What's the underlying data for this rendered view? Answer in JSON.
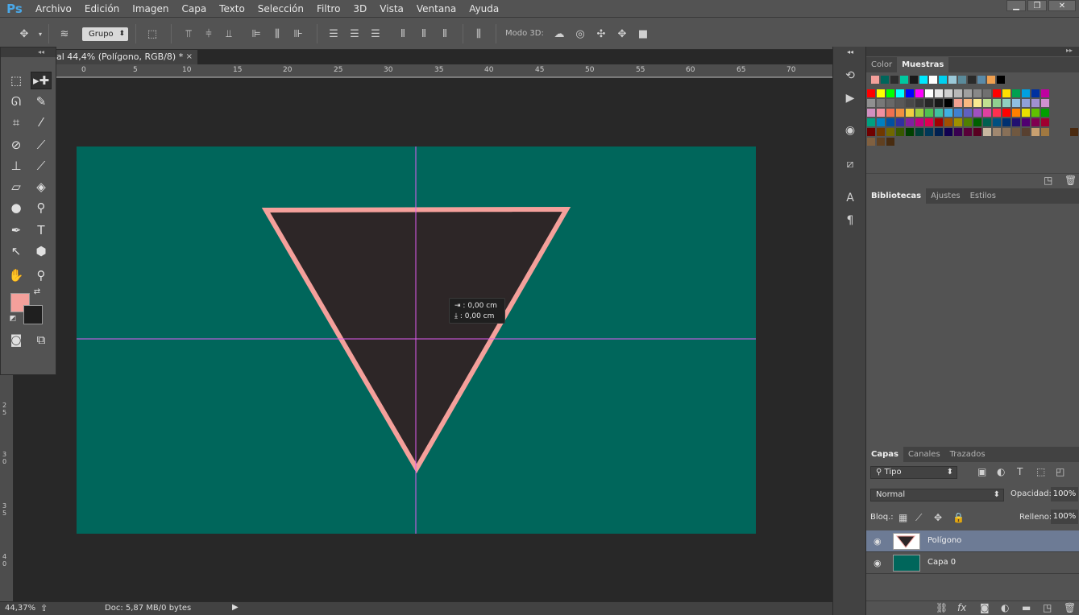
{
  "app": {
    "logo": "Ps"
  },
  "menu": [
    "Archivo",
    "Edición",
    "Imagen",
    "Capa",
    "Texto",
    "Selección",
    "Filtro",
    "3D",
    "Vista",
    "Ventana",
    "Ayuda"
  ],
  "window_controls": [
    "minimize-icon",
    "restore-icon",
    "close-icon"
  ],
  "options_bar": {
    "auto_select_value": "Grupo",
    "modo3d_label": "Modo 3D:"
  },
  "document": {
    "tab_title": "al 44,4% (Polígono, RGB/8) *",
    "close_glyph": "×"
  },
  "ruler": {
    "top_ticks": [
      "0",
      "5",
      "10",
      "15",
      "20",
      "25",
      "30",
      "35",
      "40",
      "45",
      "50",
      "55",
      "60",
      "65",
      "70"
    ],
    "left_ticks": [
      "2 5",
      "3 0",
      "3 5",
      "4 0"
    ]
  },
  "canvas": {
    "background": "#00665b",
    "shape_fill": "#2d2627",
    "shape_stroke": "#f4a09b",
    "guide_color": "#e05cf0"
  },
  "tooltip": {
    "line1": "0,00 cm",
    "line2": "0,00 cm"
  },
  "status": {
    "zoom": "44,37%",
    "doc": "Doc: 5,87 MB/0 bytes"
  },
  "colors": {
    "foreground": "#f4a09b",
    "background": "#1f1f1f"
  },
  "swatches_panel": {
    "tabs": [
      "Color",
      "Muestras"
    ],
    "active_tab": "Muestras"
  },
  "libraries_panel": {
    "tabs": [
      "Bibliotecas",
      "Ajustes",
      "Estilos"
    ],
    "active_tab": "Bibliotecas"
  },
  "layers_panel": {
    "tabs": [
      "Capas",
      "Canales",
      "Trazados"
    ],
    "active_tab": "Capas",
    "filter_kind": "Tipo",
    "blend_mode": "Normal",
    "opacity_label": "Opacidad:",
    "opacity_value": "100%",
    "lock_label": "Bloq.:",
    "fill_label": "Relleno:",
    "fill_value": "100%",
    "layers": [
      {
        "name": "Polígono",
        "visible": true,
        "selected": true
      },
      {
        "name": "Capa 0",
        "visible": true,
        "selected": false
      }
    ],
    "footer_fx": "fx"
  }
}
